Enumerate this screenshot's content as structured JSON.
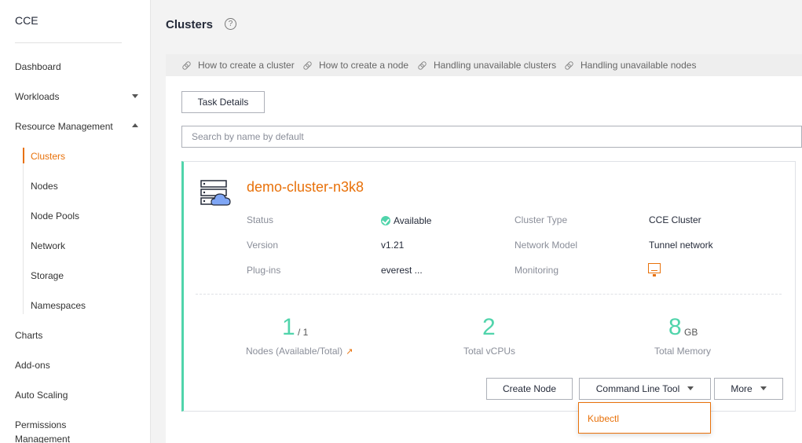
{
  "sidebar": {
    "brand": "CCE",
    "items": {
      "dashboard": "Dashboard",
      "workloads": "Workloads",
      "resource_management": "Resource Management",
      "clusters": "Clusters",
      "nodes": "Nodes",
      "node_pools": "Node Pools",
      "network": "Network",
      "storage": "Storage",
      "namespaces": "Namespaces",
      "charts": "Charts",
      "addons": "Add-ons",
      "auto_scaling": "Auto Scaling",
      "permissions_line1": "Permissions",
      "permissions_line2": "Management"
    },
    "accent_color": "#e8710a"
  },
  "header": {
    "title": "Clusters",
    "help": "?"
  },
  "help_links": [
    "How to create a cluster",
    "How to create a node",
    "Handling unavailable clusters",
    "Handling unavailable nodes"
  ],
  "toolbar": {
    "task_details": "Task Details",
    "search_placeholder": "Search by name by default"
  },
  "cluster": {
    "name": "demo-cluster-n3k8",
    "status_label": "Status",
    "status_value": "Available",
    "version_label": "Version",
    "version_value": "v1.21",
    "plugins_label": "Plug-ins",
    "plugins_value": "everest ...",
    "type_label": "Cluster Type",
    "type_value": "CCE Cluster",
    "network_label": "Network Model",
    "network_value": "Tunnel network",
    "monitoring_label": "Monitoring",
    "stats": {
      "nodes_available": "1",
      "nodes_total": "/ 1",
      "nodes_label": "Nodes (Available/Total)",
      "vcpus": "2",
      "vcpus_label": "Total vCPUs",
      "memory": "8",
      "memory_unit": "GB",
      "memory_label": "Total Memory"
    },
    "actions": {
      "create_node": "Create Node",
      "command_line_tool": "Command Line Tool",
      "more": "More"
    },
    "dropdown_items": [
      "Kubectl"
    ],
    "status_color": "#50d4ab"
  }
}
